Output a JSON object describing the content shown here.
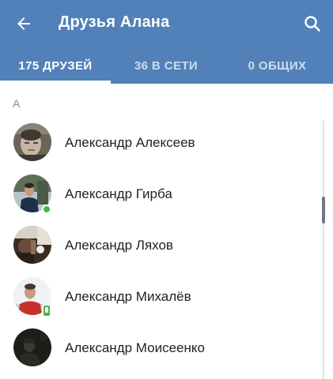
{
  "header": {
    "title": "Друзья Алана",
    "back_icon": "arrow-left-icon",
    "search_icon": "search-icon",
    "background_color": "#5181b8"
  },
  "tabs": [
    {
      "label": "175 ДРУЗЕЙ",
      "selected": true
    },
    {
      "label": "36 В СЕТИ",
      "selected": false
    },
    {
      "label": "0 ОБЩИХ",
      "selected": false
    }
  ],
  "section": {
    "letter": "А"
  },
  "friends": [
    {
      "name": "Александр Алексеев",
      "online": "none"
    },
    {
      "name": "Александр Гирба",
      "online": "web"
    },
    {
      "name": "Александр Ляхов",
      "online": "none"
    },
    {
      "name": "Александр Михалёв",
      "online": "mobile"
    },
    {
      "name": "Александр Моисеенко",
      "online": "none"
    }
  ],
  "colors": {
    "online": "#4bb34b",
    "section_header": "#818c99"
  }
}
